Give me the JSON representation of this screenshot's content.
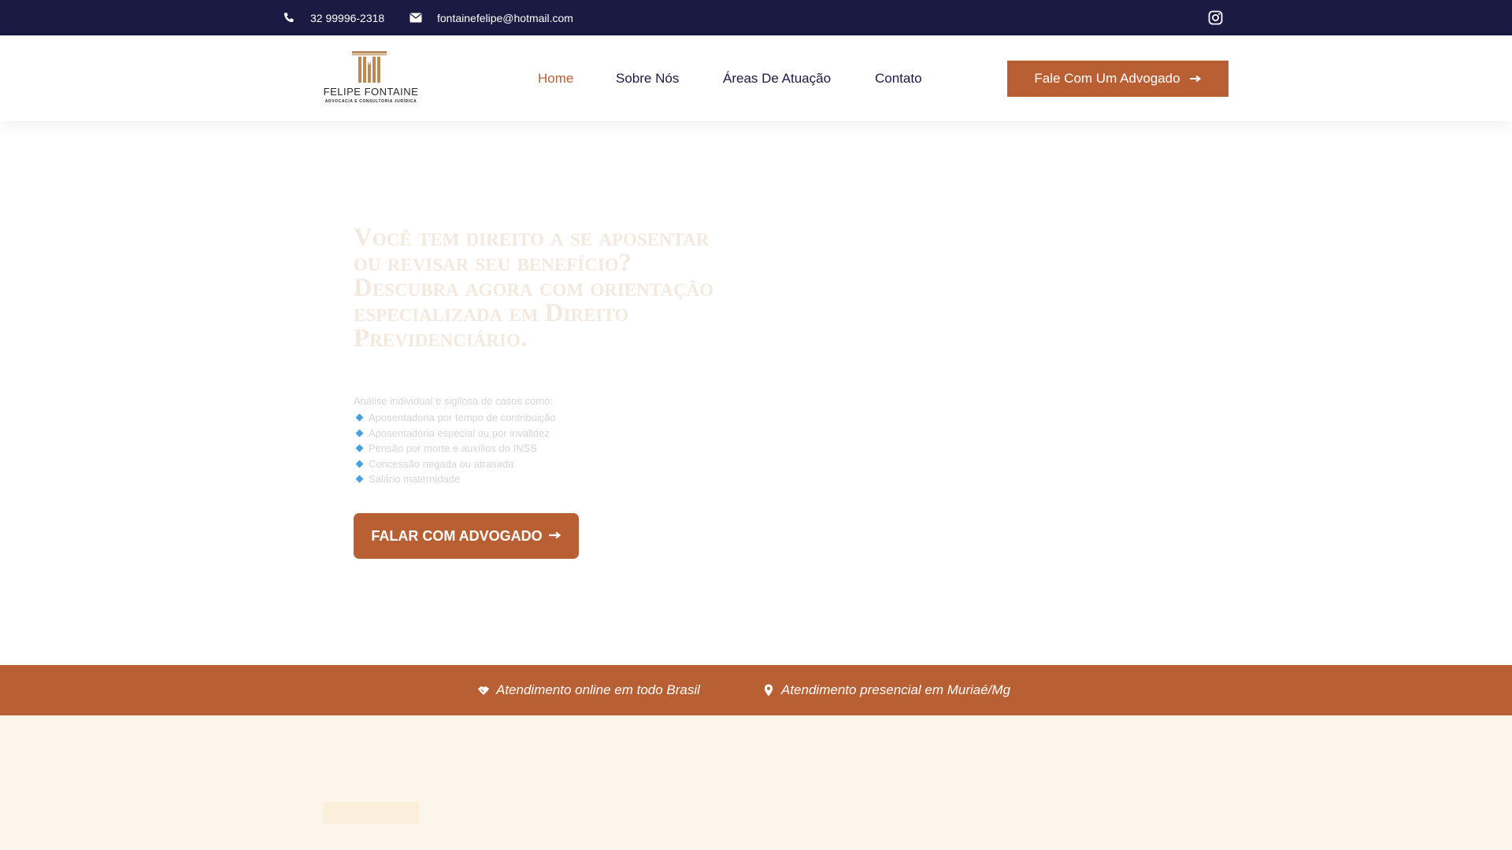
{
  "topbar": {
    "phone": "32 99996-2318",
    "email": "fontainefelipe@hotmail.com",
    "icons": {
      "phone": "phone-icon",
      "email": "envelope-icon",
      "social": "instagram-icon"
    }
  },
  "header": {
    "logo": {
      "name": "FELIPE FONTAINE",
      "tagline": "ADVOCACIA E CONSULTORIA JURÍDICA"
    },
    "nav": {
      "home": "Home",
      "sobre": "Sobre Nós",
      "areas": "Áreas De Atuação",
      "contato": "Contato"
    },
    "cta_label": "Fale Com Um Advogado"
  },
  "hero": {
    "title": "Você tem direito a se aposentar ou revisar seu benefício? Descubra agora com orientação especializada em Direito Previdenciário.",
    "intro": "Análise individual e sigilosa de casos como:",
    "items": [
      "Aposentadoria por tempo de contribuição",
      "Aposentadoria especial ou por invalidez",
      "Pensão por morte e auxílios do INSS",
      "Concessão negada ou atrasada",
      "Salário maternidade"
    ],
    "cta_label": "FALAR COM ADVOGADO"
  },
  "strip": {
    "online": "Atendimento online em todo Brasil",
    "presencial": "Atendimento presencial em Muriaé/Mg",
    "icons": {
      "online": "handshake-icon",
      "presencial": "map-pin-icon"
    }
  },
  "colors": {
    "navy": "#1b1a42",
    "accent": "#b85f34",
    "cream": "#fdf5ea",
    "bullet": "#4a9fe0"
  }
}
